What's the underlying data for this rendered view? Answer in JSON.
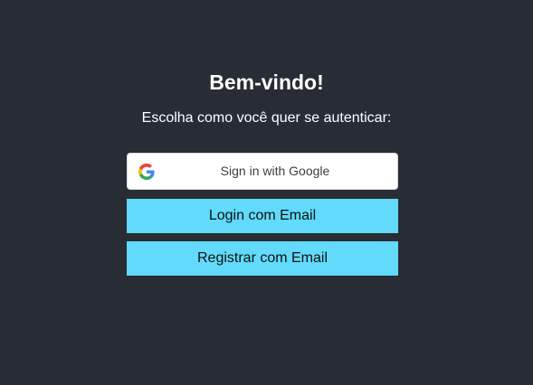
{
  "welcome": {
    "title": "Bem-vindo!",
    "subtitle": "Escolha como você quer se autenticar:"
  },
  "buttons": {
    "google": {
      "label": "Sign in with Google",
      "icon": "google-icon"
    },
    "login_email": "Login com Email",
    "register_email": "Registrar com Email"
  },
  "colors": {
    "background": "#282c34",
    "accent": "#61dafb",
    "google_button": "#ffffff"
  }
}
